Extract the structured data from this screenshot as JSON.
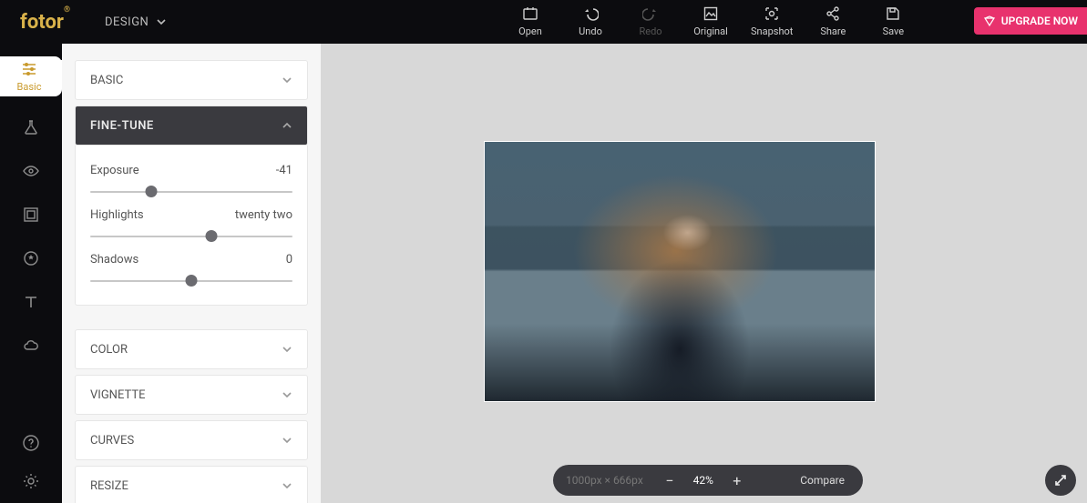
{
  "header": {
    "logo": "fotor",
    "logo_mark": "®",
    "design_label": "DESIGN",
    "actions": {
      "open": "Open",
      "undo": "Undo",
      "redo": "Redo",
      "original": "Original",
      "snapshot": "Snapshot",
      "share": "Share",
      "save": "Save"
    },
    "upgrade": "UPGRADE NOW"
  },
  "rail": {
    "basic": "Basic"
  },
  "panel": {
    "basic": "BASIC",
    "finetune": "FINE-TUNE",
    "color": "COLOR",
    "vignette": "VIGNETTE",
    "curves": "CURVES",
    "resize": "RESIZE",
    "exposure_label": "Exposure",
    "exposure_value": "-41",
    "highlights_label": "Highlights",
    "highlights_value": "twenty two",
    "shadows_label": "Shadows",
    "shadows_value": "0"
  },
  "status": {
    "dimensions": "1000px × 666px",
    "minus": "−",
    "plus": "+",
    "zoom": "42%",
    "compare": "Compare"
  }
}
